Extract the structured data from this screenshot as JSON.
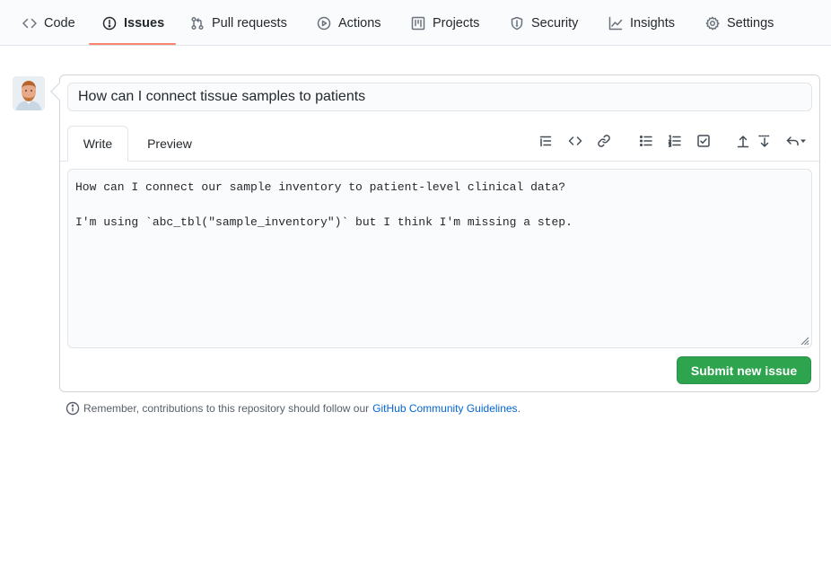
{
  "colors": {
    "accent_underline": "#f9826c",
    "submit_green": "#2ea44f",
    "link_blue": "#0366d6"
  },
  "repo_nav": {
    "items": [
      {
        "label": "Code",
        "icon": "code-icon"
      },
      {
        "label": "Issues",
        "icon": "issue-opened-icon",
        "selected": true
      },
      {
        "label": "Pull requests",
        "icon": "git-pull-request-icon"
      },
      {
        "label": "Actions",
        "icon": "play-icon"
      },
      {
        "label": "Projects",
        "icon": "project-icon"
      },
      {
        "label": "Security",
        "icon": "shield-icon"
      },
      {
        "label": "Insights",
        "icon": "graph-icon"
      },
      {
        "label": "Settings",
        "icon": "gear-icon"
      }
    ]
  },
  "issue_form": {
    "title_value": "How can I connect tissue samples to patients",
    "tabs": [
      {
        "label": "Write",
        "active": true
      },
      {
        "label": "Preview",
        "active": false
      }
    ],
    "toolbar_icons": [
      "heading-icon",
      "code-icon",
      "link-icon",
      "unordered-list-icon",
      "ordered-list-icon",
      "task-list-icon",
      "upload-icon",
      "download-icon",
      "reply-icon"
    ],
    "body_lines": [
      "How can I connect our sample inventory to patient-level clinical data?",
      "",
      "I'm using `abc_tbl(\"sample_inventory\")` but I think I'm missing a step."
    ],
    "submit_label": "Submit new issue"
  },
  "footnote": {
    "prefix": "Remember, contributions to this repository should follow our",
    "link_text": "GitHub Community Guidelines",
    "suffix": "."
  }
}
